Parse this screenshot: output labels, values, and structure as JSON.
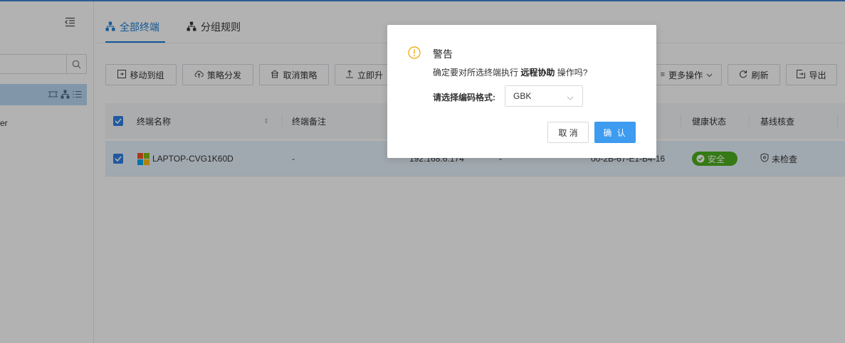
{
  "sidebar": {
    "tree_node_label": "er"
  },
  "tabs": [
    {
      "label": "全部终端",
      "icon": "topology-icon",
      "active": true
    },
    {
      "label": "分组规则",
      "icon": "topology-icon",
      "active": false
    }
  ],
  "toolbar": {
    "move_to_group": "移动到组",
    "policy_dispatch": "策略分发",
    "cancel_policy": "取消策略",
    "upgrade_now": "立即升",
    "more_actions": "更多操作",
    "refresh": "刷新",
    "export": "导出"
  },
  "table": {
    "columns": [
      "终端名称",
      "终端备注",
      "健康状态",
      "基线核查"
    ],
    "rows": [
      {
        "name": "LAPTOP-CVG1K60D",
        "remark": "-",
        "ip": "192.168.6.174",
        "extra": "-",
        "mac": "00-2B-67-E1-B4-16",
        "health": "安全",
        "baseline": "未检查"
      }
    ]
  },
  "dialog": {
    "title": "警告",
    "message_prefix": "确定要对所选终端执行",
    "message_bold": "远程协助",
    "message_suffix": "操作吗?",
    "encoding_label": "请选择编码格式:",
    "encoding_value": "GBK",
    "cancel_label": "取 消",
    "ok_label": "确 认"
  },
  "colors": {
    "accent": "#1c7ed6",
    "primary_button": "#3d9bf0",
    "warning": "#f2b01e",
    "safe": "#4caf1f"
  }
}
